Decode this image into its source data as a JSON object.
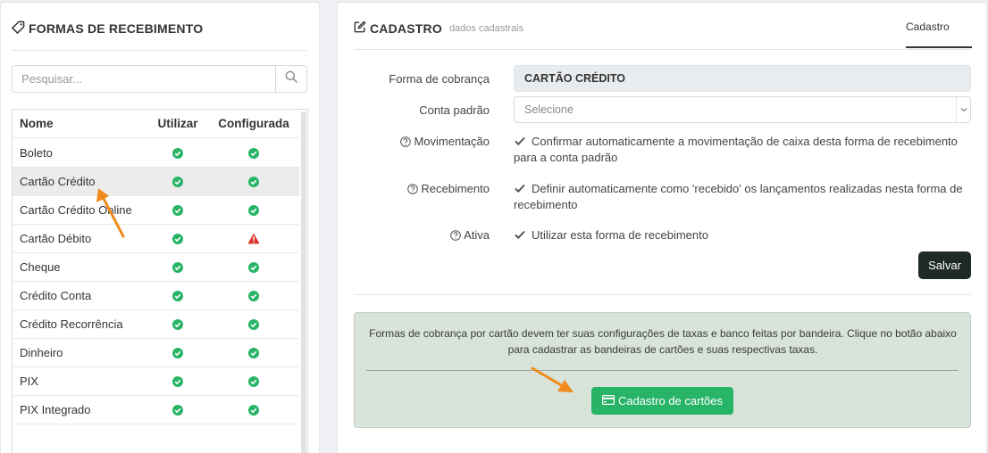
{
  "left_panel": {
    "title": "FORMAS DE RECEBIMENTO",
    "title_icon": "tag-icon",
    "search": {
      "placeholder": "Pesquisar...",
      "value": "",
      "icon": "search-icon"
    },
    "table": {
      "columns": [
        "Nome",
        "Utilizar",
        "Configurada"
      ],
      "rows": [
        {
          "nome": "Boleto",
          "utilizar": "check",
          "configurada": "check",
          "selected": false
        },
        {
          "nome": "Cartão Crédito",
          "utilizar": "check",
          "configurada": "check",
          "selected": true
        },
        {
          "nome": "Cartão Crédito Online",
          "utilizar": "check",
          "configurada": "check",
          "selected": false
        },
        {
          "nome": "Cartão Débito",
          "utilizar": "check",
          "configurada": "warning",
          "selected": false
        },
        {
          "nome": "Cheque",
          "utilizar": "check",
          "configurada": "check",
          "selected": false
        },
        {
          "nome": "Crédito Conta",
          "utilizar": "check",
          "configurada": "check",
          "selected": false
        },
        {
          "nome": "Crédito Recorrência",
          "utilizar": "check",
          "configurada": "check",
          "selected": false
        },
        {
          "nome": "Dinheiro",
          "utilizar": "check",
          "configurada": "check",
          "selected": false
        },
        {
          "nome": "PIX",
          "utilizar": "check",
          "configurada": "check",
          "selected": false
        },
        {
          "nome": "PIX Integrado",
          "utilizar": "check",
          "configurada": "check",
          "selected": false
        }
      ]
    }
  },
  "right_panel": {
    "title": "CADASTRO",
    "subtitle": "dados cadastrais",
    "title_icon": "edit-icon",
    "tab": "Cadastro",
    "form": {
      "forma_cobranca_label": "Forma de cobrança",
      "forma_cobranca_value": "CARTÃO CRÉDITO",
      "conta_padrao_label": "Conta padrão",
      "conta_padrao_value": "Selecione",
      "movimentacao_label": "Movimentação",
      "movimentacao_text": "Confirmar automaticamente a movimentação de caixa desta forma de recebimento para a conta padrão",
      "recebimento_label": "Recebimento",
      "recebimento_text": "Definir automaticamente como 'recebido' os lançamentos realizadas nesta forma de recebimento",
      "ativa_label": "Ativa",
      "ativa_text": "Utilizar esta forma de recebimento",
      "save_label": "Salvar"
    },
    "info": {
      "text": "Formas de cobrança por cartão devem ter suas configurações de taxas e banco feitas por bandeira. Clique no botão abaixo para cadastrar as bandeiras de cartões e suas respectivas taxas.",
      "button_label": "Cadastro de cartões",
      "button_icon": "credit-card-icon"
    }
  },
  "colors": {
    "check_green": "#28b467",
    "warning_red": "#d9342b",
    "accent_orange": "#f08a1c",
    "save_button": "#1f2a26",
    "info_bg": "#d8e3da"
  }
}
